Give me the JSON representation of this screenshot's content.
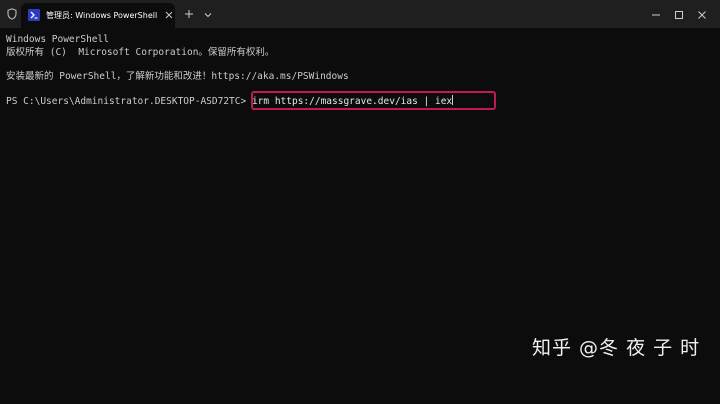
{
  "titlebar": {
    "tab_title": "管理员: Windows PowerShell",
    "icons": {
      "shield": "shield-icon",
      "app": "powershell-icon",
      "close_tab": "close-icon",
      "new_tab": "plus-icon",
      "dropdown": "chevron-down-icon",
      "minimize": "minimize-icon",
      "maximize": "maximize-icon",
      "close_window": "close-icon"
    }
  },
  "terminal": {
    "lines": [
      "Windows PowerShell",
      "版权所有 (C)  Microsoft Corporation。保留所有权利。",
      "安装最新的 PowerShell，了解新功能和改进！https://aka.ms/PSWindows"
    ],
    "prompt": "PS C:\\Users\\Administrator.DESKTOP-ASD72TC> ",
    "command": "irm https://massgrave.dev/ias | iex"
  },
  "watermark": "知乎 @冬 夜 子 时",
  "colors": {
    "terminal_bg": "#0c0c0c",
    "titlebar_bg": "#1f1f1f",
    "text": "#cccccc",
    "highlight_border": "#c2185b",
    "icon_blue": "#2b3bc2"
  }
}
